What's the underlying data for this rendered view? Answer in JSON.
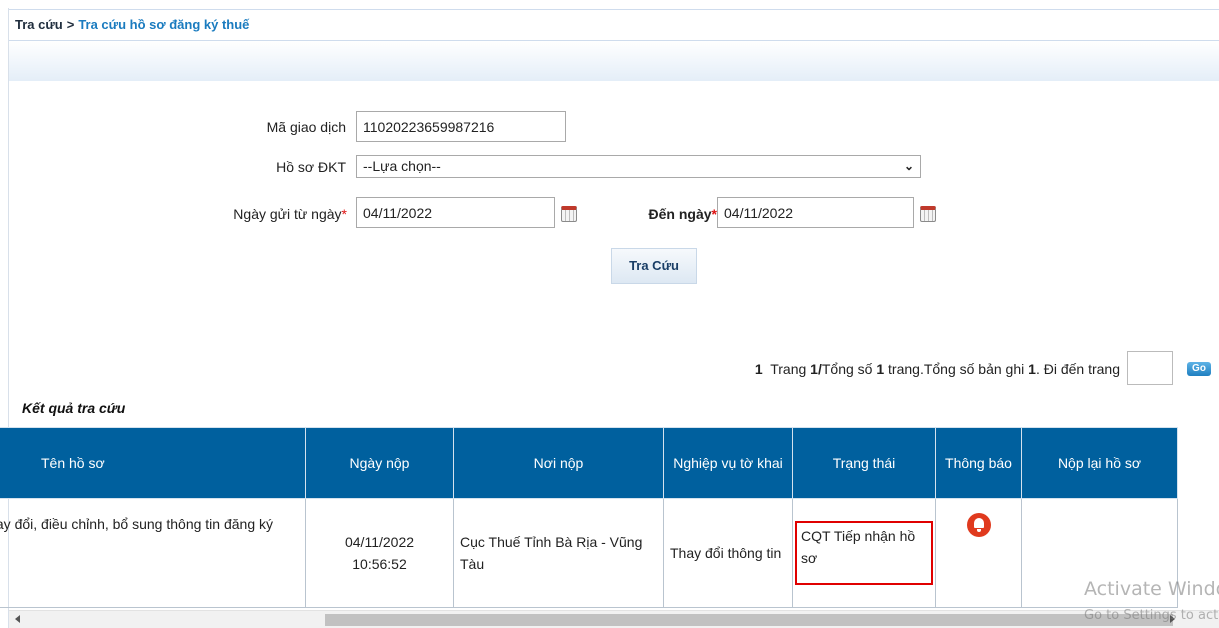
{
  "breadcrumb": {
    "root": "Tra cứu",
    "separator": ">",
    "current": "Tra cứu hồ sơ đăng ký thuế"
  },
  "form": {
    "transaction_code_label": "Mã giao dịch",
    "transaction_code_value": "11020223659987216",
    "dossier_label": "Hồ sơ ĐKT",
    "dossier_selected": "--Lựa chọn--",
    "from_date_label": "Ngày gửi từ ngày",
    "from_date_value": "04/11/2022",
    "to_date_label": "Đến ngày",
    "to_date_value": "04/11/2022",
    "required_mark": "*",
    "search_button": "Tra Cứu"
  },
  "pager": {
    "current_page": "1",
    "text_trang": "Trang",
    "page_of": "1/",
    "text_tong_so": "Tổng số",
    "total_pages": "1",
    "text_trang_tong_ban_ghi": "trang.Tổng số bản ghi",
    "total_records": "1",
    "text_go_to": ". Đi đến trang",
    "goto_value": "",
    "go_label": "Go"
  },
  "results": {
    "title": "Kết quả tra cứu",
    "columns": [
      "Tên hồ sơ",
      "Ngày nộp",
      "Nơi nộp",
      "Nghiệp vụ tờ khai",
      "Trạng thái",
      "Thông báo",
      "Nộp lại hồ sơ"
    ],
    "rows": [
      {
        "name": "Thay đổi, điều chỉnh, bổ sung thông tin đăng ký",
        "submit_date": "04/11/2022",
        "submit_time": "10:56:52",
        "place": "Cục Thuế Tỉnh Bà Rịa - Vũng Tàu",
        "operation": "Thay đổi thông tin",
        "status": "CQT Tiếp nhận hồ sơ",
        "notice_icon": "bell-icon",
        "resubmit": ""
      }
    ]
  },
  "watermark": {
    "line1": "Activate Windows",
    "line2": "Go to Settings to activate Windows."
  },
  "colors": {
    "header_bg": "#00609e",
    "link": "#1a7bbf",
    "status_highlight": "#e00000",
    "bell": "#e03a1e"
  }
}
